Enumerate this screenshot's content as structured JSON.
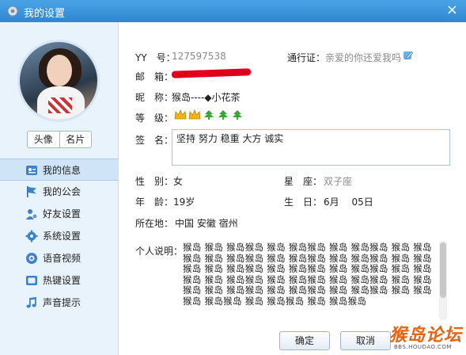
{
  "window": {
    "title": "我的设置",
    "close_glyph": "×"
  },
  "profile": {
    "tabs": [
      "头像",
      "名片"
    ]
  },
  "nav": {
    "items": [
      {
        "label": "我的信息",
        "icon": "profile-card-icon",
        "active": true
      },
      {
        "label": "我的公会",
        "icon": "flag-icon",
        "active": false
      },
      {
        "label": "好友设置",
        "icon": "friend-settings-icon",
        "active": false
      },
      {
        "label": "系统设置",
        "icon": "gear-icon",
        "active": false
      },
      {
        "label": "语音视频",
        "icon": "voice-video-icon",
        "active": false
      },
      {
        "label": "热键设置",
        "icon": "hotkey-icon",
        "active": false
      },
      {
        "label": "声音提示",
        "icon": "music-note-icon",
        "active": false
      }
    ]
  },
  "info": {
    "yy_label": "YY　号：",
    "yy_value": "127597538",
    "passport_label": "通行证：",
    "passport_value": "亲爱的你还爱我吗",
    "email_label": "邮　箱：",
    "nickname_label": "昵　称：",
    "nickname_value": "猴岛----◆小花茶",
    "level_label": "等　级：",
    "signature_label": "签　名：",
    "signature_value": "坚持 努力 稳重 大方 诚实",
    "gender_label": "性　别：",
    "gender_value": "女",
    "zodiac_label": "星　座：",
    "zodiac_value": "双子座",
    "age_label": "年　龄：",
    "age_value": "19岁",
    "birthday_label": "生　日：",
    "birthday_value": "6月　 05日",
    "location_label": "所在地：",
    "location_value": "中国 安徽 宿州",
    "description_label": "个人说明：",
    "description_value": "猴岛 猴岛 猴岛猴岛 猴岛 猴岛猴岛 猴岛 猴岛猴岛 猴岛 猴岛猴岛 猴岛 猴岛猴岛 猴岛 猴岛猴岛 猴岛 猴岛猴岛 猴岛 猴岛猴岛 猴岛 猴岛猴岛 猴岛 猴岛猴岛 猴岛 猴岛猴岛 猴岛 猴岛猴岛 猴岛 猴岛猴岛 猴岛 猴岛猴岛 猴岛 猴岛猴岛 猴岛 猴岛猴岛 猴岛 猴岛猴岛 猴岛 猴岛猴岛 猴岛 猴岛猴岛 猴岛 猴岛 猴岛 猴岛猴岛 猴岛 猴岛猴岛 猴岛 猴岛猴岛"
  },
  "buttons": {
    "ok": "确定",
    "cancel": "取消"
  },
  "watermark": {
    "text": "猴岛论坛",
    "sub": "BBS.HOUDAO.COM"
  },
  "colors": {
    "titlebar": "#2f86d2",
    "sidebar": "#e9f3fb",
    "active_nav": "#cfe4f6",
    "email_redaction": "#e0001b",
    "crown": "#f2b21a",
    "leaf": "#3aa63a"
  }
}
